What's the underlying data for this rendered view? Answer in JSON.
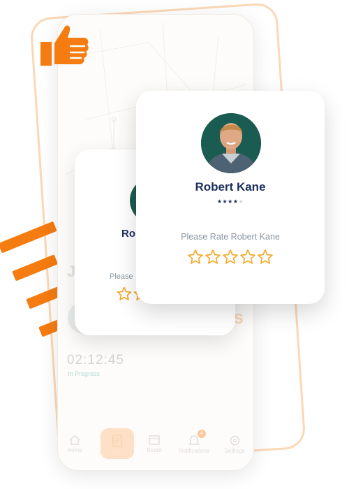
{
  "phone": {
    "background_letter": "J",
    "background_accent": "S",
    "timer": "02:12:45",
    "timer_status": "In Progress",
    "nav": [
      {
        "label": "Home",
        "icon": "home-icon",
        "active": false
      },
      {
        "label": "Jobs",
        "icon": "jobs-icon",
        "active": true
      },
      {
        "label": "Board",
        "icon": "board-icon",
        "active": false
      },
      {
        "label": "Notifications",
        "icon": "bell-icon",
        "active": false,
        "badge": "4"
      },
      {
        "label": "Settings",
        "icon": "gear-icon",
        "active": false
      }
    ]
  },
  "rating_card_back": {
    "name": "Ro",
    "prompt": "Please"
  },
  "rating_card": {
    "name": "Robert Kane",
    "current_rating": 4,
    "max_rating": 5,
    "prompt": "Please Rate Robert Kane",
    "stars_selected": 0
  },
  "colors": {
    "accent": "#f57c10",
    "name_text": "#1d2f5d",
    "prompt_text": "#8a97a3",
    "star_outline": "#f5a623"
  }
}
